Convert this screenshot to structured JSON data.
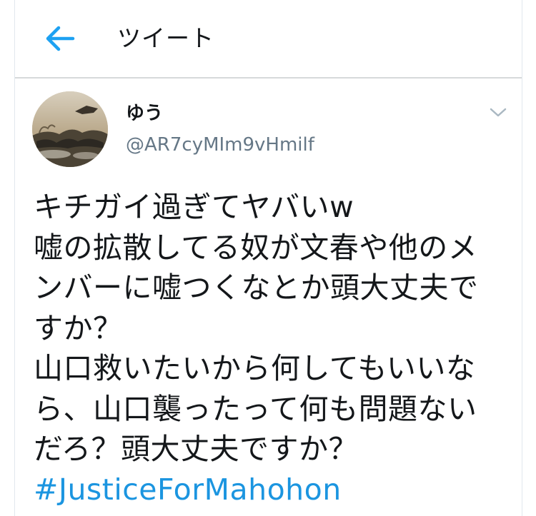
{
  "header": {
    "title": "ツイート",
    "back_icon": "arrow-left-icon",
    "accent_color": "#1da1f2"
  },
  "tweet": {
    "author": {
      "display_name": "ゆう",
      "handle": "@AR7cyMIm9vHmilf"
    },
    "caret_icon": "chevron-down-icon",
    "text_lines": [
      "キチガイ過ぎてヤバいw",
      "嘘の拡散してる奴が文春や他のメ",
      "ンバーに嘘つくなとか頭大丈夫で",
      "すか？",
      "山口救いたいから何してもいいな",
      "ら、山口襲ったって何も問題ない",
      "だろ？頭大丈夫ですか？"
    ],
    "hashtag": "#JusticeForMahohon",
    "hashtag_color": "#1b95e0"
  }
}
